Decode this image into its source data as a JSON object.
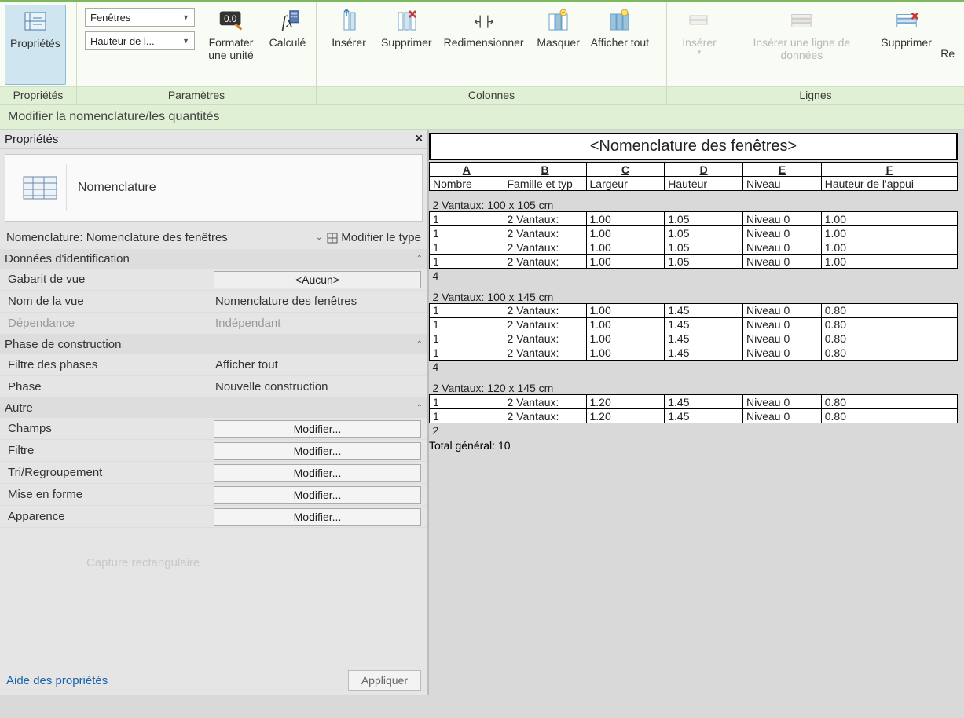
{
  "ribbon": {
    "groups": {
      "properties": {
        "label": "Propriétés",
        "props_btn": "Propriétés"
      },
      "parameters": {
        "label": "Paramètres",
        "combo1": "Fenêtres",
        "combo2": "Hauteur de l...",
        "format_unit": "Formater une unité",
        "calculated": "Calculé"
      },
      "columns": {
        "label": "Colonnes",
        "insert": "Insérer",
        "delete": "Supprimer",
        "resize": "Redimensionner",
        "hide": "Masquer",
        "show_all": "Afficher tout"
      },
      "rows": {
        "label": "Lignes",
        "insert": "Insérer",
        "insert_data_row": "Insérer une ligne de données",
        "delete": "Supprimer",
        "re": "Re"
      }
    }
  },
  "context_title": "Modifier la nomenclature/les quantités",
  "left": {
    "panel_title": "Propriétés",
    "type_name": "Nomenclature",
    "instance_label": "Nomenclature: Nomenclature des fenêtres",
    "edit_type": "Modifier le type",
    "sections": {
      "ident": {
        "title": "Données d'identification",
        "rows": {
          "template": {
            "label": "Gabarit de vue",
            "btn": "<Aucun>"
          },
          "view_name": {
            "label": "Nom de la vue",
            "value": "Nomenclature des fenêtres"
          },
          "dependency": {
            "label": "Dépendance",
            "value": "Indépendant"
          }
        }
      },
      "phase": {
        "title": "Phase de construction",
        "rows": {
          "filter": {
            "label": "Filtre des phases",
            "value": "Afficher tout"
          },
          "phase": {
            "label": "Phase",
            "value": "Nouvelle construction"
          }
        }
      },
      "other": {
        "title": "Autre",
        "rows": {
          "fields": {
            "label": "Champs",
            "btn": "Modifier..."
          },
          "filter": {
            "label": "Filtre",
            "btn": "Modifier..."
          },
          "sort": {
            "label": "Tri/Regroupement",
            "btn": "Modifier..."
          },
          "format": {
            "label": "Mise en forme",
            "btn": "Modifier..."
          },
          "appear": {
            "label": "Apparence",
            "btn": "Modifier..."
          }
        }
      }
    },
    "ghost_text": "Capture rectangulaire",
    "help": "Aide des propriétés",
    "apply": "Appliquer"
  },
  "schedule": {
    "title": "<Nomenclature des fenêtres>",
    "col_letters": [
      "A",
      "B",
      "C",
      "D",
      "E",
      "F"
    ],
    "headers": [
      "Nombre",
      "Famille et typ",
      "Largeur",
      "Hauteur",
      "Niveau",
      "Hauteur de l'appui"
    ],
    "groups": [
      {
        "title": "2 Vantaux: 100 x 105 cm",
        "rows": [
          [
            "1",
            "2 Vantaux:",
            "1.00",
            "1.05",
            "Niveau 0",
            "1.00"
          ],
          [
            "1",
            "2 Vantaux:",
            "1.00",
            "1.05",
            "Niveau 0",
            "1.00"
          ],
          [
            "1",
            "2 Vantaux:",
            "1.00",
            "1.05",
            "Niveau 0",
            "1.00"
          ],
          [
            "1",
            "2 Vantaux:",
            "1.00",
            "1.05",
            "Niveau 0",
            "1.00"
          ]
        ],
        "subtotal": "4"
      },
      {
        "title": "2 Vantaux: 100 x 145 cm",
        "rows": [
          [
            "1",
            "2 Vantaux:",
            "1.00",
            "1.45",
            "Niveau 0",
            "0.80"
          ],
          [
            "1",
            "2 Vantaux:",
            "1.00",
            "1.45",
            "Niveau 0",
            "0.80"
          ],
          [
            "1",
            "2 Vantaux:",
            "1.00",
            "1.45",
            "Niveau 0",
            "0.80"
          ],
          [
            "1",
            "2 Vantaux:",
            "1.00",
            "1.45",
            "Niveau 0",
            "0.80"
          ]
        ],
        "subtotal": "4"
      },
      {
        "title": "2 Vantaux: 120 x 145 cm",
        "rows": [
          [
            "1",
            "2 Vantaux:",
            "1.20",
            "1.45",
            "Niveau 0",
            "0.80"
          ],
          [
            "1",
            "2 Vantaux:",
            "1.20",
            "1.45",
            "Niveau 0",
            "0.80"
          ]
        ],
        "subtotal": "2"
      }
    ],
    "grand_total": "Total général: 10"
  }
}
